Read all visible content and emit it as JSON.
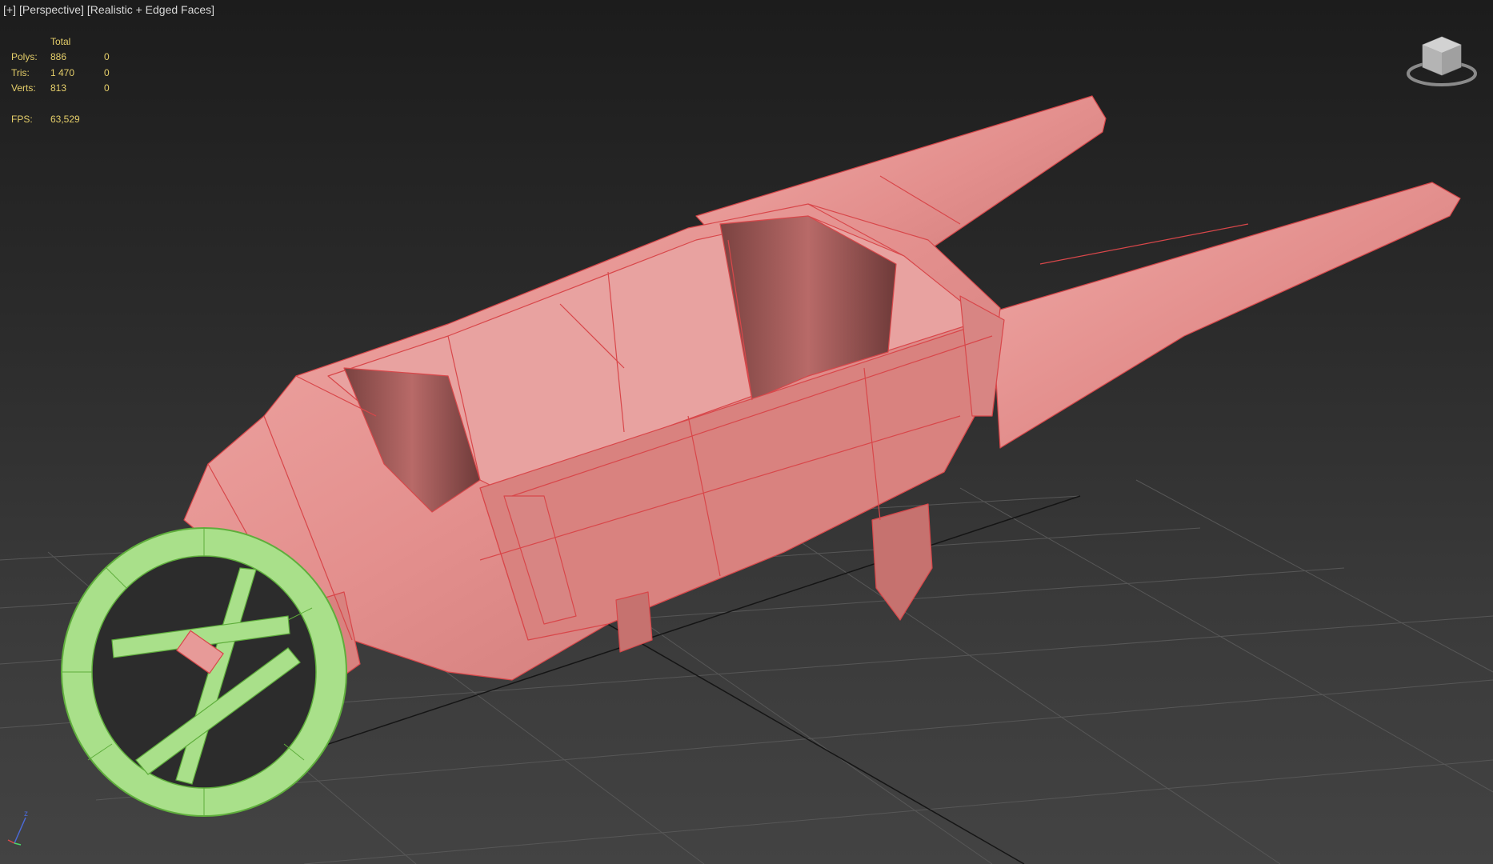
{
  "viewport": {
    "labels": {
      "plus": "[+]",
      "view": "[Perspective]",
      "shading": "[Realistic + Edged Faces]"
    },
    "stats": {
      "header": "Total",
      "rows": [
        {
          "label": "Polys:",
          "total": "886",
          "selected": "0"
        },
        {
          "label": "Tris:",
          "total": "1 470",
          "selected": "0"
        },
        {
          "label": "Verts:",
          "total": "813",
          "selected": "0"
        }
      ],
      "fps_label": "FPS:",
      "fps_value": "63,529"
    },
    "viewcube": {
      "icon": "viewcube-icon"
    },
    "axis": {
      "z_label": "z"
    },
    "colors": {
      "stats_text": "#e6cf6a",
      "label_text": "#d8d8d8",
      "body_fill": "#e79a98",
      "body_edge": "#d8474a",
      "wheel_fill": "#a9e08a",
      "wheel_edge": "#5fae3c",
      "grid": "#575757"
    }
  }
}
